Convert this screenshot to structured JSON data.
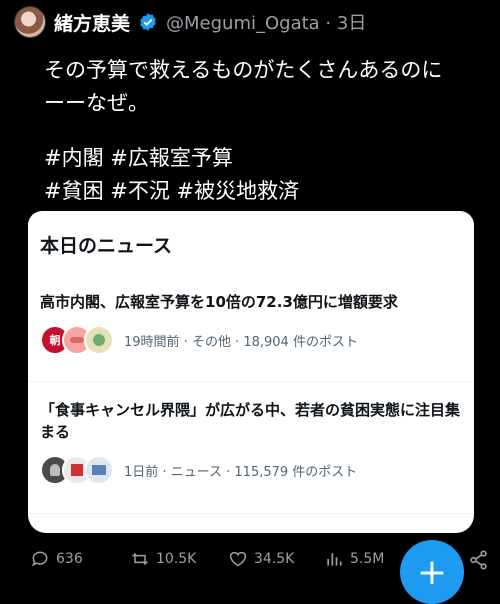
{
  "header": {
    "display_name": "緒方恵美",
    "handle_time": "@Megumi_Ogata · 3日"
  },
  "tweet": {
    "text": "その予算で救えるものがたくさんあるのに\nーーなぜ。",
    "hashtags_line1": "#内閣 #広報室予算",
    "hashtags_line2": "#貧困 #不況 #被災地救済"
  },
  "news_card": {
    "title": "本日のニュース",
    "items": [
      {
        "headline": "高市内閣、広報室予算を10倍の72.3億円に増額要求",
        "meta": "19時間前 · その他 · 18,904 件のポスト",
        "avatar_badge": "朝"
      },
      {
        "headline": "「食事キャンセル界隈」が広がる中、若者の貧困実態に注目集まる",
        "meta": "1日前 · ニュース · 115,579 件のポスト"
      }
    ]
  },
  "actions": {
    "replies": "636",
    "reposts": "10.5K",
    "likes": "34.5K",
    "views": "5.5M"
  },
  "colors": {
    "accent": "#1d9bf0",
    "background": "#000000",
    "card": "#ffffff"
  }
}
